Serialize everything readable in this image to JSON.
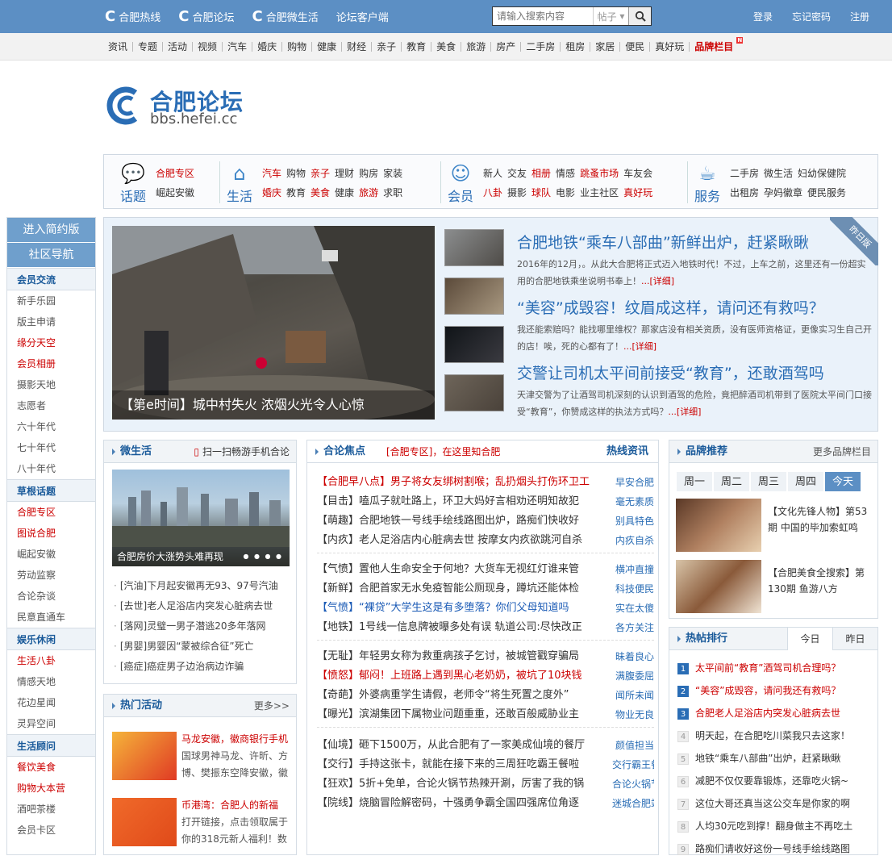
{
  "topbar": {
    "links": [
      "合肥热线",
      "合肥论坛",
      "合肥微生活",
      "论坛客户端"
    ],
    "search_placeholder": "请输入搜索内容",
    "search_type": "帖子",
    "user": [
      "登录",
      "忘记密码",
      "注册"
    ]
  },
  "nav": {
    "items": [
      "资讯",
      "专题",
      "活动",
      "视频",
      "汽车",
      "婚庆",
      "购物",
      "健康",
      "财经",
      "亲子",
      "教育",
      "美食",
      "旅游",
      "房产",
      "二手房",
      "租房",
      "家居",
      "便民",
      "真好玩"
    ],
    "hot": "品牌栏目",
    "hot_badge": "N"
  },
  "logo": {
    "title": "合肥论坛",
    "url_text": "bbs.hefei.cc"
  },
  "categories": [
    {
      "label": "话题",
      "row1": [
        {
          "t": "合肥专区",
          "red": true
        }
      ],
      "row2": [
        {
          "t": "崛起安徽",
          "red": false
        }
      ]
    },
    {
      "label": "生活",
      "row1": [
        {
          "t": "汽车",
          "red": true
        },
        {
          "t": "购物",
          "red": false
        },
        {
          "t": "亲子",
          "red": true
        },
        {
          "t": "理财",
          "red": false
        },
        {
          "t": "购房",
          "red": false
        },
        {
          "t": "家装",
          "red": false
        }
      ],
      "row2": [
        {
          "t": "婚庆",
          "red": true
        },
        {
          "t": "教育",
          "red": false
        },
        {
          "t": "美食",
          "red": true
        },
        {
          "t": "健康",
          "red": false
        },
        {
          "t": "旅游",
          "red": true
        },
        {
          "t": "求职",
          "red": false
        }
      ]
    },
    {
      "label": "会员",
      "row1": [
        {
          "t": "新人",
          "red": false
        },
        {
          "t": "交友",
          "red": false
        },
        {
          "t": "相册",
          "red": true
        },
        {
          "t": "情感",
          "red": false
        },
        {
          "t": "跳蚤市场",
          "red": true
        },
        {
          "t": "车友会",
          "red": false
        }
      ],
      "row2": [
        {
          "t": "八卦",
          "red": true
        },
        {
          "t": "摄影",
          "red": false
        },
        {
          "t": "球队",
          "red": true
        },
        {
          "t": "电影",
          "red": false
        },
        {
          "t": "业主社区",
          "red": false
        },
        {
          "t": "真好玩",
          "red": true
        }
      ]
    },
    {
      "label": "服务",
      "row1": [
        {
          "t": "二手房",
          "red": false
        },
        {
          "t": "微生活",
          "red": false
        },
        {
          "t": "妇幼保健院",
          "red": false
        }
      ],
      "row2": [
        {
          "t": "出租房",
          "red": false
        },
        {
          "t": "孕妈徽章",
          "red": false
        },
        {
          "t": "便民服务",
          "red": false
        }
      ]
    }
  ],
  "sidebar": {
    "btn1": "进入简约版",
    "btn2": "社区导航",
    "sections": [
      {
        "title": "会员交流",
        "items": [
          {
            "t": "新手乐园",
            "red": false
          },
          {
            "t": "版主申请",
            "red": false
          },
          {
            "t": "缘分天空",
            "red": true
          },
          {
            "t": "会员相册",
            "red": true
          },
          {
            "t": "摄影天地",
            "red": false
          },
          {
            "t": "志愿者",
            "red": false
          },
          {
            "t": "六十年代",
            "red": false
          },
          {
            "t": "七十年代",
            "red": false
          },
          {
            "t": "八十年代",
            "red": false
          }
        ]
      },
      {
        "title": "草根话题",
        "items": [
          {
            "t": "合肥专区",
            "red": true
          },
          {
            "t": "图说合肥",
            "red": true
          },
          {
            "t": "崛起安徽",
            "red": false
          },
          {
            "t": "劳动监察",
            "red": false
          },
          {
            "t": "合论杂谈",
            "red": false
          },
          {
            "t": "民意直通车",
            "red": false
          }
        ]
      },
      {
        "title": "娱乐休闲",
        "items": [
          {
            "t": "生活八卦",
            "red": true
          },
          {
            "t": "情感天地",
            "red": false
          },
          {
            "t": "花边星闻",
            "red": false
          },
          {
            "t": "灵异空间",
            "red": false
          }
        ]
      },
      {
        "title": "生活顾问",
        "items": [
          {
            "t": "餐饮美食",
            "red": true
          },
          {
            "t": "购物大本营",
            "red": true
          },
          {
            "t": "酒吧茶楼",
            "red": false
          },
          {
            "t": "会员卡区",
            "red": false
          }
        ]
      }
    ]
  },
  "feature": {
    "caption": "【第e时间】城中村失火 浓烟火光令人心惊",
    "ribbon": "昨日版",
    "news": [
      {
        "title": "合肥地铁“乘车八部曲”新鲜出炉，赶紧瞅瞅",
        "desc": "2016年的12月，。从此大合肥将正式迈入地铁时代！不过，上车之前，这里还有一份超实用的合肥地铁乘坐说明书奉上！",
        "more": "...[详细]"
      },
      {
        "title": "“美容”成毁容！纹眉成这样，请问还有救吗？",
        "desc": "我还能索赔吗？能找哪里维权？那家店没有相关资质，没有医师资格证，更像实习生自己开的店！唉，死的心都有了！",
        "more": "...[详细]"
      },
      {
        "title": "交警让司机太平间前接受“教育”，还敢酒驾吗",
        "desc": "天津交警为了让酒驾司机深刻的认识到酒驾的危险，竟把醉酒司机带到了医院太平间门口接受“教育”，你赞成这样的执法方式吗？",
        "more": "...[详细]"
      }
    ]
  },
  "weishenghuo": {
    "title": "微生活",
    "qr": "扫一扫畅游手机合论",
    "pic_caption": "合肥房价大涨势头难再现",
    "items": [
      "[汽油]下月起安徽再无93、97号汽油",
      "[去世]老人足浴店内突发心脏病去世",
      "[落网]灵璧一男子潜逃20多年落网",
      "[男婴]男婴因“蒙被综合征”死亡",
      "[癌症]癌症男子边治病边诈骗"
    ]
  },
  "activity": {
    "title": "热门活动",
    "more": "更多>>",
    "items": [
      {
        "title": "马龙安徽，徽商银行手机",
        "desc": "国球男神马龙、许昕、方博、樊振东空降安徽，徽"
      },
      {
        "title": "币港湾：合肥人的新福",
        "desc": "打开链接，点击领取属于你的318元新人福利！数"
      }
    ]
  },
  "focus": {
    "tab1": "合论焦点",
    "tab2": "[合肥专区]，在这里知合肥",
    "tab3": "热线资讯",
    "groups": [
      [
        {
          "main": "【合肥早八点】男子将女友绑树割喉；乱扔烟头打伤环卫工",
          "side": "早安合肥",
          "cls": "red"
        },
        {
          "main": "【目击】嗑瓜子就吐路上，环卫大妈好言相劝还明知故犯",
          "side": "毫无素质",
          "cls": ""
        },
        {
          "main": "【萌趣】合肥地铁一号线手绘线路图出炉，路痴们快收好",
          "side": "别具特色",
          "cls": ""
        },
        {
          "main": "【内疚】老人足浴店内心脏病去世 按摩女内疚欲跳河自杀",
          "side": "内疚自杀",
          "cls": ""
        }
      ],
      [
        {
          "main": "【气愤】置他人生命安全于何地？大货车无视红灯谁来管",
          "side": "横冲直撞",
          "cls": ""
        },
        {
          "main": "【新鲜】合肥首家无水免疫智能公厕现身，蹲坑还能体检",
          "side": "科技便民",
          "cls": ""
        },
        {
          "main": "【气愤】“裸贷”大学生这是有多堕落？你们父母知道吗",
          "side": "实在太傻",
          "cls": "blue"
        },
        {
          "main": "【地铁】1号线一信息牌被曝多处有误 轨道公司:尽快改正",
          "side": "各方关注",
          "cls": ""
        }
      ],
      [
        {
          "main": "【无耻】年轻男女称为救重病孩子乞讨，被城管戳穿骗局",
          "side": "昧着良心",
          "cls": ""
        },
        {
          "main": "【愤怒】郁闷！上班路上遇到黑心老奶奶，被坑了10块钱",
          "side": "满腹委屈",
          "cls": "red"
        },
        {
          "main": "【奇葩】外婆病重学生请假，老师令“将生死置之度外”",
          "side": "闻所未闻",
          "cls": ""
        },
        {
          "main": "【曝光】滨湖集团下属物业问题重重，还敢百般威胁业主",
          "side": "物业无良",
          "cls": ""
        }
      ],
      [
        {
          "main": "【仙境】砸下1500万，从此合肥有了一家美成仙境的餐厅",
          "side": "颜值担当",
          "cls": ""
        },
        {
          "main": "【交行】手持这张卡，就能在接下来的三周狂吃霸王餐啦",
          "side": "交行霸王餐",
          "cls": ""
        },
        {
          "main": "【狂欢】5折+免单，合论火锅节热辣开涮，厉害了我的锅",
          "side": "合论火锅节",
          "cls": ""
        },
        {
          "main": "【院线】烧脑冒险解密码，十强勇争霸全国四强席位角逐",
          "side": "迷城合肥站",
          "cls": ""
        }
      ]
    ]
  },
  "brand": {
    "title": "品牌推荐",
    "more": "更多品牌栏目",
    "days": [
      "周一",
      "周二",
      "周三",
      "周四",
      "今天"
    ],
    "items": [
      {
        "text": "【文化先锋人物】第53期 中国的毕加索虹鸣"
      },
      {
        "text": "【合肥美食全搜索】第130期 鱼游八方"
      }
    ]
  },
  "hot": {
    "title": "热帖排行",
    "tabs": [
      "今日",
      "昨日"
    ],
    "items": [
      {
        "n": "1",
        "t": "太平间前“教育”酒驾司机合理吗？",
        "top": true
      },
      {
        "n": "2",
        "t": "“美容”成毁容，请问我还有救吗？",
        "top": true
      },
      {
        "n": "3",
        "t": "合肥老人足浴店内突发心脏病去世",
        "top": true
      },
      {
        "n": "4",
        "t": "明天起，在合肥吃川菜我只去这家！",
        "top": false
      },
      {
        "n": "5",
        "t": "地铁“乘车八部曲”出炉，赶紧瞅瞅",
        "top": false
      },
      {
        "n": "6",
        "t": "减肥不仅仅要靠锻炼，还靠吃火锅~",
        "top": false
      },
      {
        "n": "7",
        "t": "这位大哥还真当这公交车是你家的啊",
        "top": false
      },
      {
        "n": "8",
        "t": "人均30元吃到撑！翻身做主不再吃土",
        "top": false
      },
      {
        "n": "9",
        "t": "路痴们请收好这份一号线手绘线路图",
        "top": false
      }
    ]
  }
}
